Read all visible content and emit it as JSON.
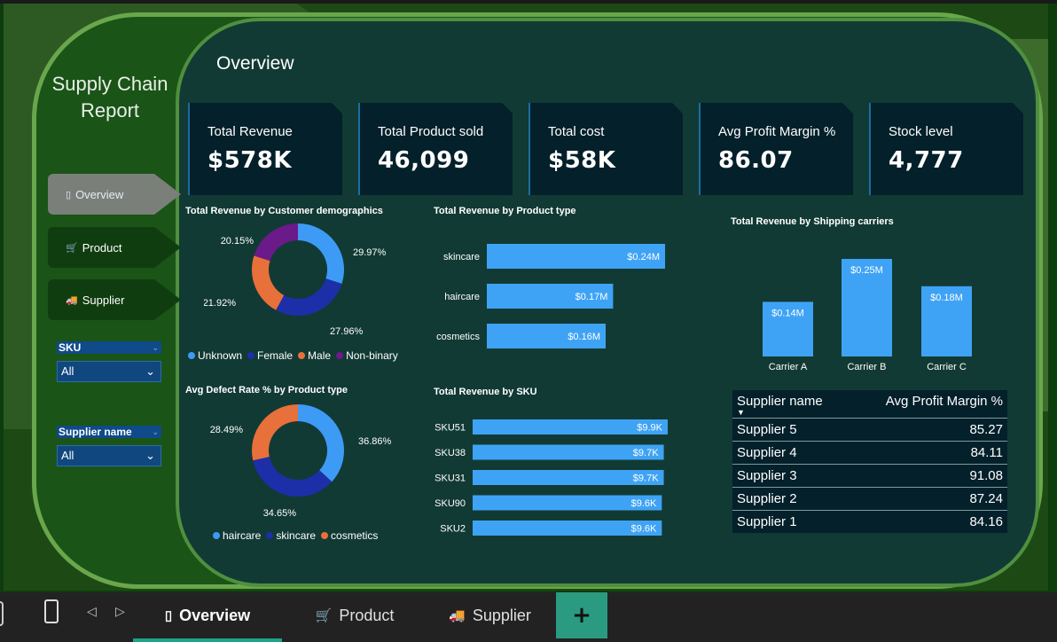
{
  "report": {
    "title_line1": "Supply Chain",
    "title_line2": "Report"
  },
  "page_title": "Overview",
  "nav": [
    {
      "label": "Overview",
      "icon": "page-icon"
    },
    {
      "label": "Product",
      "icon": "cart-icon"
    },
    {
      "label": "Supplier",
      "icon": "truck-icon"
    }
  ],
  "slicers": [
    {
      "label": "SKU",
      "value": "All"
    },
    {
      "label": "Supplier name",
      "value": "All"
    }
  ],
  "kpis": [
    {
      "label": "Total Revenue",
      "value": "$578K"
    },
    {
      "label": "Total Product sold",
      "value": "46,099"
    },
    {
      "label": "Total cost",
      "value": "$58K"
    },
    {
      "label": "Avg Profit Margin %",
      "value": "86.07"
    },
    {
      "label": "Stock level",
      "value": "4,777"
    }
  ],
  "colors": {
    "blue": "#3d9bf5",
    "navy": "#1c2fa8",
    "orange": "#e8703a",
    "purple": "#6b1a8a",
    "bar": "#3fa3f5"
  },
  "chart_data": [
    {
      "id": "demographics",
      "type": "pie",
      "title": "Total Revenue by Customer demographics",
      "categories": [
        "Unknown",
        "Female",
        "Male",
        "Non-binary"
      ],
      "values": [
        29.97,
        27.96,
        21.92,
        20.15
      ],
      "labels": [
        "29.97%",
        "27.96%",
        "21.92%",
        "20.15%"
      ],
      "colors": [
        "#3d9bf5",
        "#1c2fa8",
        "#e8703a",
        "#6b1a8a"
      ]
    },
    {
      "id": "defect",
      "type": "pie",
      "title": "Avg Defect Rate % by Product type",
      "categories": [
        "haircare",
        "skincare",
        "cosmetics"
      ],
      "values": [
        36.86,
        34.65,
        28.49
      ],
      "labels": [
        "36.86%",
        "34.65%",
        "28.49%"
      ],
      "colors": [
        "#3d9bf5",
        "#1c2fa8",
        "#e8703a"
      ]
    },
    {
      "id": "product",
      "type": "bar",
      "title": "Total Revenue by Product type",
      "categories": [
        "skincare",
        "haircare",
        "cosmetics"
      ],
      "values": [
        0.24,
        0.17,
        0.16
      ],
      "labels": [
        "$0.24M",
        "$0.17M",
        "$0.16M"
      ],
      "xlim": [
        0,
        0.24
      ]
    },
    {
      "id": "sku",
      "type": "bar",
      "title": "Total Revenue by SKU",
      "categories": [
        "SKU51",
        "SKU38",
        "SKU31",
        "SKU90",
        "SKU2"
      ],
      "values": [
        9.9,
        9.7,
        9.7,
        9.6,
        9.6
      ],
      "labels": [
        "$9.9K",
        "$9.7K",
        "$9.7K",
        "$9.6K",
        "$9.6K"
      ],
      "xlim": [
        0,
        9.9
      ]
    },
    {
      "id": "carriers",
      "type": "bar",
      "title": "Total Revenue by Shipping carriers",
      "categories": [
        "Carrier A",
        "Carrier B",
        "Carrier C"
      ],
      "values": [
        0.14,
        0.25,
        0.18
      ],
      "labels": [
        "$0.14M",
        "$0.25M",
        "$0.18M"
      ],
      "ylim": [
        0,
        0.25
      ]
    }
  ],
  "table": {
    "headers": [
      "Supplier name",
      "Avg Profit Margin %"
    ],
    "rows": [
      [
        "Supplier 5",
        "85.27"
      ],
      [
        "Supplier 4",
        "84.11"
      ],
      [
        "Supplier 3",
        "91.08"
      ],
      [
        "Supplier 2",
        "87.24"
      ],
      [
        "Supplier 1",
        "84.16"
      ]
    ]
  },
  "bottom_tabs": [
    {
      "label": "Overview",
      "icon": "page-icon"
    },
    {
      "label": "Product",
      "icon": "cart-icon"
    },
    {
      "label": "Supplier",
      "icon": "truck-icon"
    }
  ]
}
